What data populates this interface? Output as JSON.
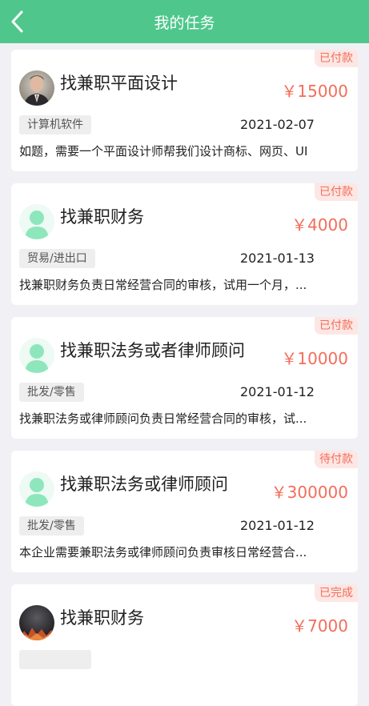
{
  "header": {
    "title": "我的任务",
    "back_icon": "chevron-left-icon"
  },
  "colors": {
    "brand": "#4fc78c",
    "accent": "#f36d5a",
    "status_bg": "#fde7e4"
  },
  "tasks": [
    {
      "status": "已付款",
      "avatar": "person-photo",
      "title": "找兼职平面设计",
      "price": "￥15000",
      "category": "计算机软件",
      "date": "2021-02-07",
      "description": "如题，需要一个平面设计师帮我们设计商标、网页、UI"
    },
    {
      "status": "已付款",
      "avatar": "default-user-icon",
      "title": "找兼职财务",
      "price": "￥4000",
      "category": "贸易/进出口",
      "date": "2021-01-13",
      "description": "找兼职财务负责日常经营合同的审核，试用一个月，..."
    },
    {
      "status": "已付款",
      "avatar": "default-user-icon",
      "title": "找兼职法务或者律师顾问",
      "price": "￥10000",
      "category": "批发/零售",
      "date": "2021-01-12",
      "description": "找兼职法务或律师顾问负责日常经营合同的审核，试..."
    },
    {
      "status": "待付款",
      "avatar": "default-user-icon",
      "title": "找兼职法务或律师顾问",
      "price": "￥300000",
      "category": "批发/零售",
      "date": "2021-01-12",
      "description": "本企业需要兼职法务或律师顾问负责审核日常经营合..."
    },
    {
      "status": "已完成",
      "avatar": "dark-photo",
      "title": "找兼职财务",
      "price": "￥7000",
      "category": "",
      "date": "",
      "description": ""
    }
  ]
}
